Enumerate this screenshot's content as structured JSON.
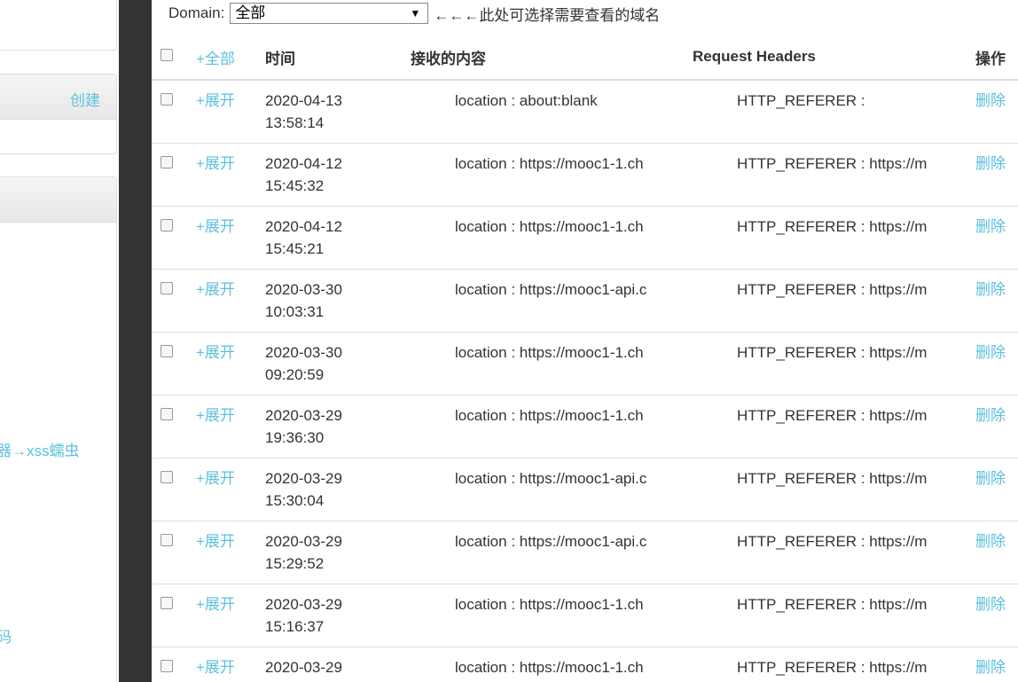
{
  "sidebar": {
    "create_label": "创建",
    "link1": "器→xss蠕虫",
    "link2": "码"
  },
  "domain": {
    "label": "Domain:",
    "selected": "全部",
    "hint": "←←←此处可选择需要查看的域名"
  },
  "table": {
    "headers": {
      "expand_all": "+全部",
      "time": "时间",
      "content": "接收的内容",
      "request_headers": "Request Headers",
      "action": "操作"
    },
    "rows": [
      {
        "expand": "+展开",
        "date": "2020-04-13",
        "time": "13:58:14",
        "content": "location : about:blank",
        "header": "HTTP_REFERER :",
        "action": "删除"
      },
      {
        "expand": "+展开",
        "date": "2020-04-12",
        "time": "15:45:32",
        "content": "location : https://mooc1-1.ch",
        "header": "HTTP_REFERER : https://m",
        "action": "删除"
      },
      {
        "expand": "+展开",
        "date": "2020-04-12",
        "time": "15:45:21",
        "content": "location : https://mooc1-1.ch",
        "header": "HTTP_REFERER : https://m",
        "action": "删除"
      },
      {
        "expand": "+展开",
        "date": "2020-03-30",
        "time": "10:03:31",
        "content": "location : https://mooc1-api.c",
        "header": "HTTP_REFERER : https://m",
        "action": "删除"
      },
      {
        "expand": "+展开",
        "date": "2020-03-30",
        "time": "09:20:59",
        "content": "location : https://mooc1-1.ch",
        "header": "HTTP_REFERER : https://m",
        "action": "删除"
      },
      {
        "expand": "+展开",
        "date": "2020-03-29",
        "time": "19:36:30",
        "content": "location : https://mooc1-1.ch",
        "header": "HTTP_REFERER : https://m",
        "action": "删除"
      },
      {
        "expand": "+展开",
        "date": "2020-03-29",
        "time": "15:30:04",
        "content": "location : https://mooc1-api.c",
        "header": "HTTP_REFERER : https://m",
        "action": "删除"
      },
      {
        "expand": "+展开",
        "date": "2020-03-29",
        "time": "15:29:52",
        "content": "location : https://mooc1-api.c",
        "header": "HTTP_REFERER : https://m",
        "action": "删除"
      },
      {
        "expand": "+展开",
        "date": "2020-03-29",
        "time": "15:16:37",
        "content": "location : https://mooc1-1.ch",
        "header": "HTTP_REFERER : https://m",
        "action": "删除"
      },
      {
        "expand": "+展开",
        "date": "2020-03-29",
        "time": "",
        "content": "location : https://mooc1-1.ch",
        "header": "HTTP_REFERER : https://m",
        "action": "删除"
      }
    ]
  },
  "colors": {
    "link": "#5bc0de",
    "gutter": "#333333",
    "border": "#dddddd"
  }
}
